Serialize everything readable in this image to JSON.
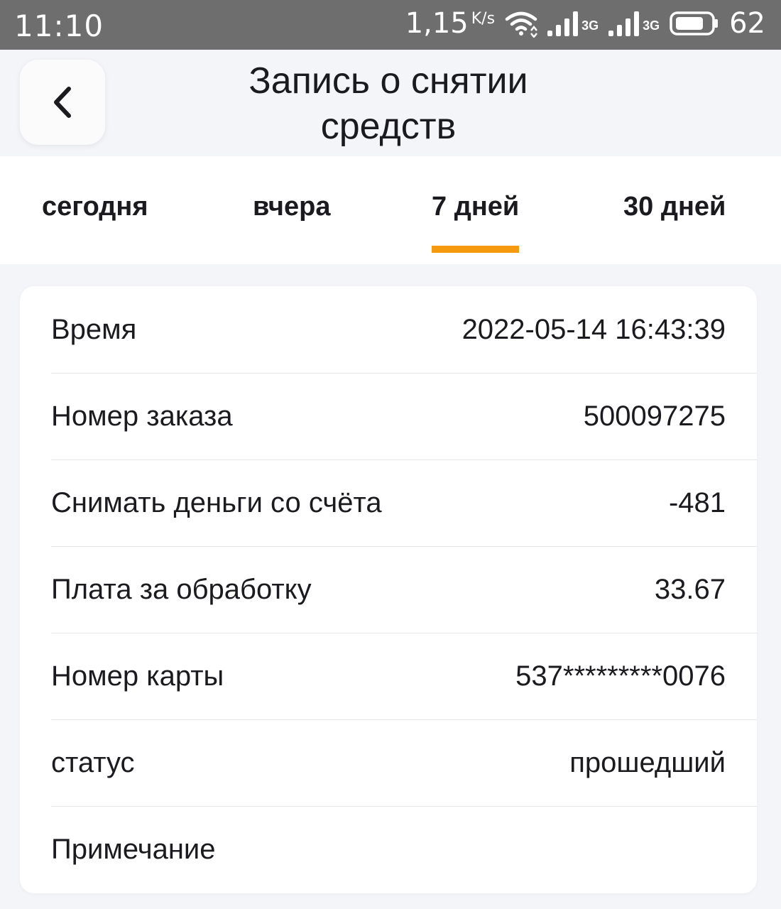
{
  "status_bar": {
    "time": "11:10",
    "speed": "1,15",
    "speed_unit": "K/s",
    "network1": "3G",
    "network2": "3G",
    "battery": "62"
  },
  "header": {
    "title_line1": "Запись о снятии",
    "title_line2": "средств"
  },
  "tabs": [
    {
      "label": "сегодня",
      "active": false
    },
    {
      "label": "вчера",
      "active": false
    },
    {
      "label": "7 дней",
      "active": true
    },
    {
      "label": "30 дней",
      "active": false
    }
  ],
  "accent_color": "#f59a0e",
  "record": [
    {
      "label": "Время",
      "value": "2022-05-14 16:43:39"
    },
    {
      "label": "Номер заказа",
      "value": "500097275"
    },
    {
      "label": "Снимать деньги со счёта",
      "value": "-481"
    },
    {
      "label": "Плата за обработку",
      "value": "33.67"
    },
    {
      "label": "Номер карты",
      "value": "537*********0076"
    },
    {
      "label": "статус",
      "value": "прошедший"
    },
    {
      "label": "Примечание",
      "value": ""
    }
  ]
}
